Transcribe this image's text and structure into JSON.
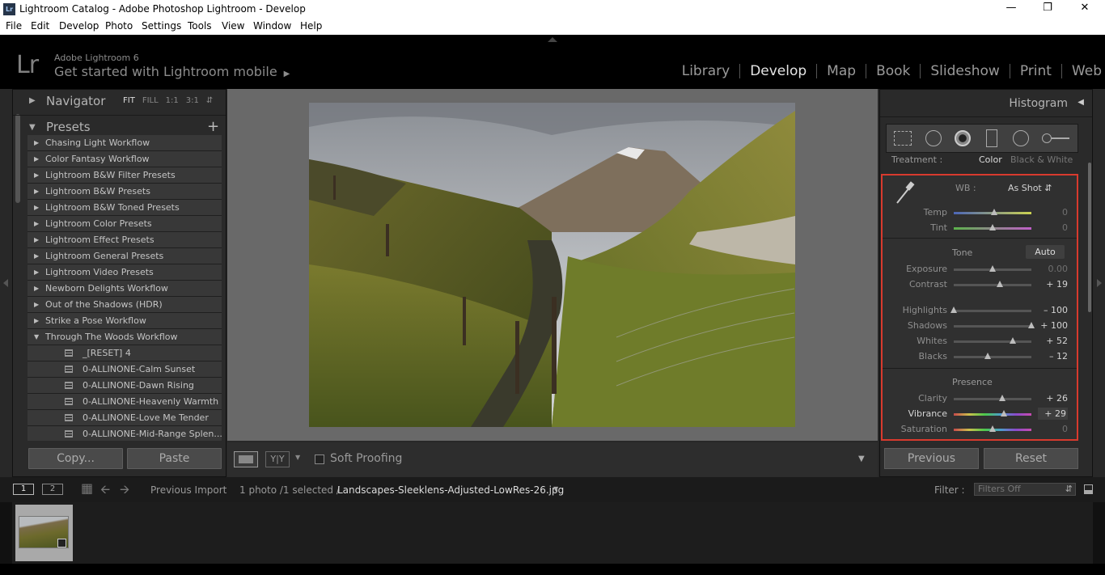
{
  "window": {
    "title": "Lightroom Catalog - Adobe Photoshop Lightroom - Develop",
    "app_icon": "Lr"
  },
  "menu": [
    "File",
    "Edit",
    "Develop",
    "Photo",
    "Settings",
    "Tools",
    "View",
    "Window",
    "Help"
  ],
  "identity": {
    "logo": "Lr",
    "product": "Adobe Lightroom 6",
    "mobile_text": "Get started with Lightroom mobile"
  },
  "modules": [
    {
      "label": "Library",
      "active": false
    },
    {
      "label": "Develop",
      "active": true
    },
    {
      "label": "Map",
      "active": false
    },
    {
      "label": "Book",
      "active": false
    },
    {
      "label": "Slideshow",
      "active": false
    },
    {
      "label": "Print",
      "active": false
    },
    {
      "label": "Web",
      "active": false
    }
  ],
  "left": {
    "navigator": {
      "title": "Navigator",
      "options": [
        "FIT",
        "FILL",
        "1:1",
        "3:1"
      ],
      "selected": "FIT"
    },
    "presets": {
      "title": "Presets",
      "add": "+",
      "folders": [
        "Chasing Light Workflow",
        "Color Fantasy Workflow",
        "Lightroom B&W Filter Presets",
        "Lightroom B&W Presets",
        "Lightroom B&W Toned Presets",
        "Lightroom Color Presets",
        "Lightroom Effect Presets",
        "Lightroom General Presets",
        "Lightroom Video Presets",
        "Newborn Delights Workflow",
        "Out of the Shadows (HDR)",
        "Strike a Pose Workflow"
      ],
      "open_folder": "Through The Woods Workflow",
      "children": [
        "_[RESET] 4",
        "0-ALLINONE-Calm Sunset",
        "0-ALLINONE-Dawn Rising",
        "0-ALLINONE-Heavenly Warmth",
        "0-ALLINONE-Love Me Tender",
        "0-ALLINONE-Mid-Range Splen..."
      ]
    },
    "copy_label": "Copy...",
    "paste_label": "Paste"
  },
  "toolbar": {
    "soft_proofing": "Soft Proofing",
    "soft_proofing_checked": false,
    "compare_label": "Y|Y"
  },
  "right": {
    "histogram": "Histogram",
    "treatment": {
      "label": "Treatment :",
      "color": "Color",
      "bw": "Black & White",
      "selected": "Color"
    },
    "wb": {
      "label": "WB :",
      "value": "As Shot"
    },
    "temp": {
      "label": "Temp",
      "value": "0",
      "pos": 0.52
    },
    "tint": {
      "label": "Tint",
      "value": "0",
      "pos": 0.5
    },
    "tone": {
      "label": "Tone",
      "auto": "Auto"
    },
    "exposure": {
      "label": "Exposure",
      "value": "0.00",
      "pos": 0.5
    },
    "contrast": {
      "label": "Contrast",
      "value": "+ 19",
      "pos": 0.595
    },
    "highlights": {
      "label": "Highlights",
      "value": "– 100",
      "pos": 0.0
    },
    "shadows": {
      "label": "Shadows",
      "value": "+ 100",
      "pos": 1.0
    },
    "whites": {
      "label": "Whites",
      "value": "+ 52",
      "pos": 0.76
    },
    "blacks": {
      "label": "Blacks",
      "value": "– 12",
      "pos": 0.44
    },
    "presence": {
      "label": "Presence"
    },
    "clarity": {
      "label": "Clarity",
      "value": "+ 26",
      "pos": 0.63
    },
    "vibrance": {
      "label": "Vibrance",
      "value": "+ 29",
      "pos": 0.645
    },
    "saturation": {
      "label": "Saturation",
      "value": "0",
      "pos": 0.5
    },
    "previous": "Previous",
    "reset": "Reset"
  },
  "filmstrip": {
    "view1": "1",
    "view2": "2",
    "source": "Previous Import",
    "count": "1 photo /1 selected /",
    "filename": "Landscapes-Sleeklens-Adjusted-LowRes-26.jpg",
    "filter_label": "Filter :",
    "filter_value": "Filters Off"
  },
  "colors": {
    "highlight": "#d83a2e",
    "bg": "#282828",
    "panel": "#2a2a2a",
    "text": "#b4b4b4"
  }
}
